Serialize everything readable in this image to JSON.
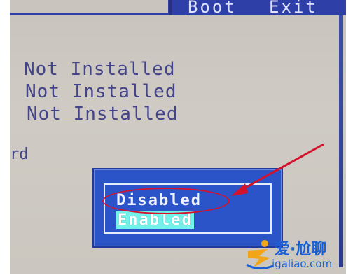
{
  "menu": {
    "items": [
      {
        "label": "Boot"
      },
      {
        "label": "Exit"
      }
    ]
  },
  "status_rows": [
    {
      "value": "Not Installed"
    },
    {
      "value": "Not Installed"
    },
    {
      "value": "Not Installed"
    }
  ],
  "edge_fragment": "rd",
  "popup": {
    "options": [
      {
        "label": "Disabled",
        "circled": true
      },
      {
        "label": "Enabled",
        "selected": true
      }
    ]
  },
  "annotation": {
    "ring_color": "#d4122c",
    "arrow_color": "#d4122c"
  },
  "watermark": {
    "title": "爱·尬聊",
    "url": "igaliao.com"
  },
  "colors": {
    "bios_blue": "#2b54c9",
    "bios_text": "#44448a",
    "selection": "#72f2e8"
  }
}
